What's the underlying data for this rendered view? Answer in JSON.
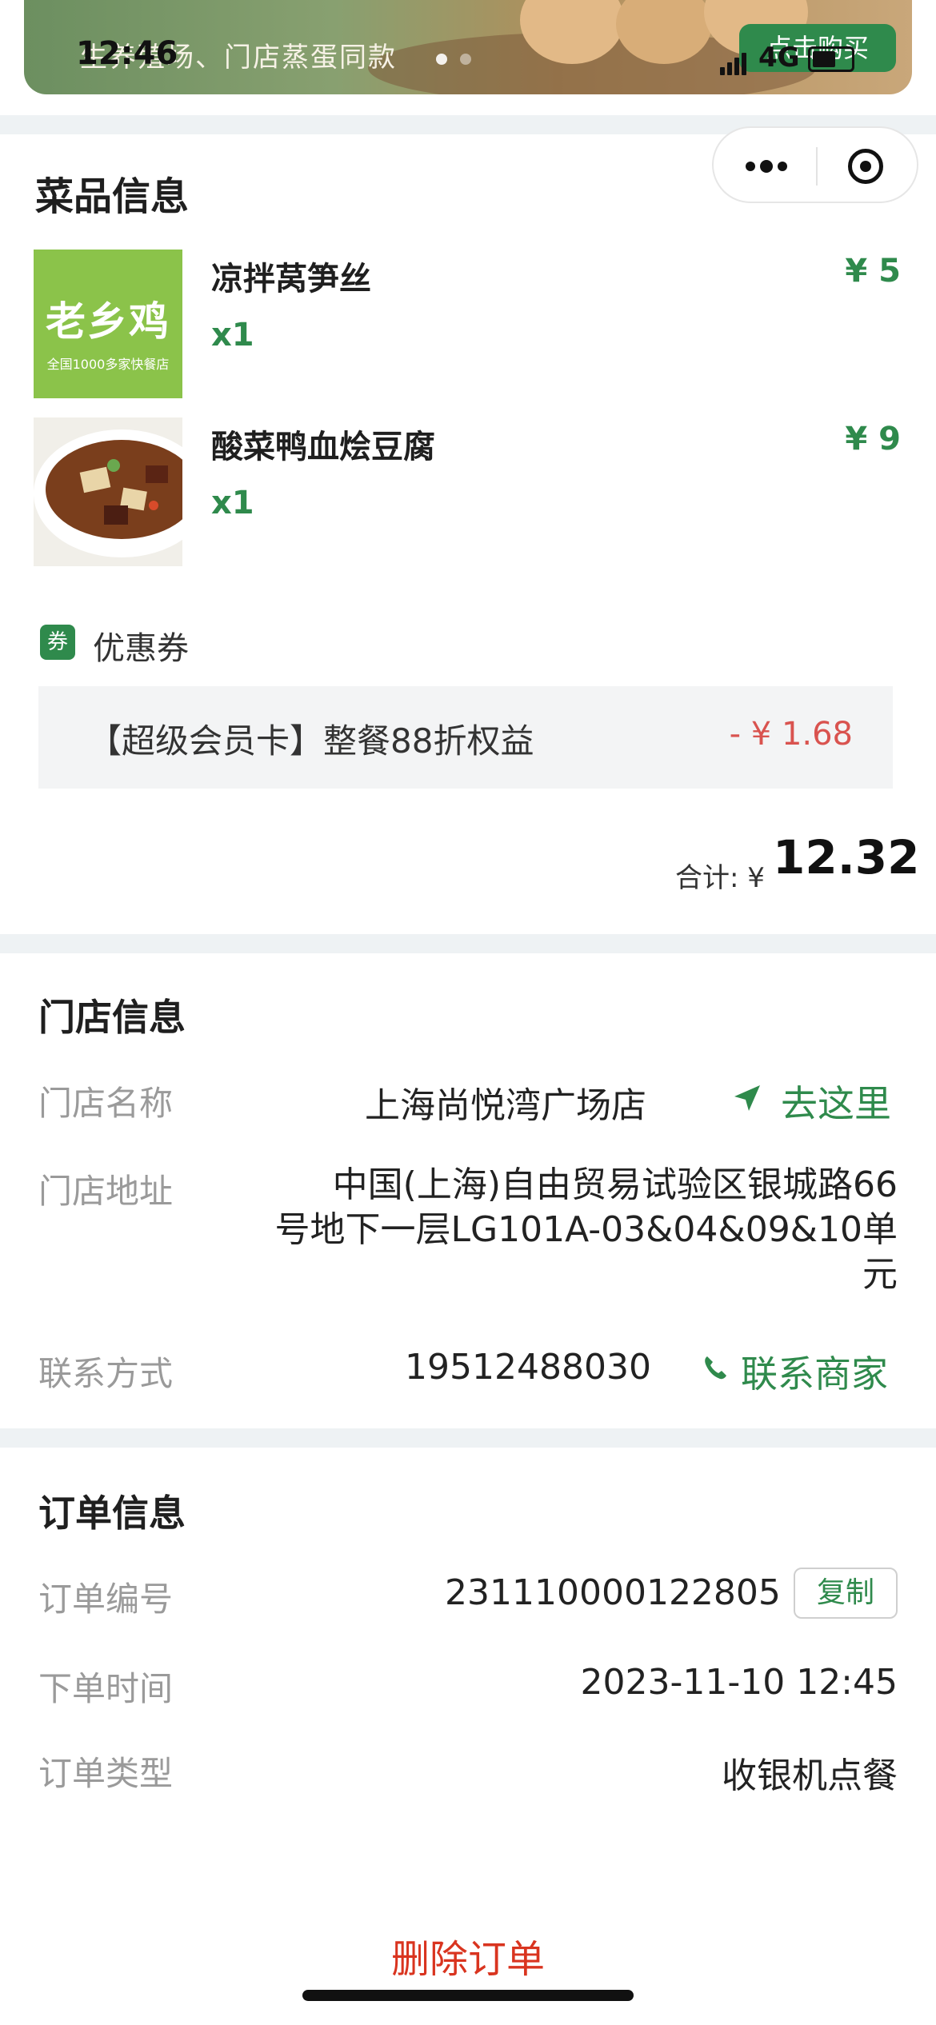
{
  "status_bar": {
    "time": "12:46",
    "network": "4G"
  },
  "banner": {
    "tagline": "生养殖场、门店蒸蛋同款",
    "button_label": "点击购买"
  },
  "dish_section": {
    "title": "菜品信息",
    "items": [
      {
        "name": "凉拌莴笋丝",
        "qty": "x1",
        "price": "¥ 5",
        "thumb": "brand-logo",
        "brand": "老乡鸡",
        "brand_sub": "全国1000多家快餐店"
      },
      {
        "name": "酸菜鸭血烩豆腐",
        "qty": "x1",
        "price": "¥ 9",
        "thumb": "soup-photo"
      }
    ],
    "coupon_badge": "券",
    "coupon_label": "优惠券",
    "coupon": {
      "name": "【超级会员卡】整餐88折权益",
      "amount": "- ¥ 1.68"
    },
    "total_label": "合计: ¥",
    "total_value": "12.32"
  },
  "store_section": {
    "title": "门店信息",
    "name_label": "门店名称",
    "name_value": "上海尚悦湾广场店",
    "navigate_label": "去这里",
    "address_label": "门店地址",
    "address_line1": "中国(上海)自由贸易试验区银城路66",
    "address_line2": "号地下一层LG101A-03&04&09&10单",
    "address_line3": "元",
    "contact_label": "联系方式",
    "contact_value": "19512488030",
    "contact_action": "联系商家"
  },
  "order_section": {
    "title": "订单信息",
    "number_label": "订单编号",
    "number_value": "231110000122805",
    "copy_label": "复制",
    "time_label": "下单时间",
    "time_value": "2023-11-10 12:45",
    "type_label": "订单类型",
    "type_value": "收银机点餐"
  },
  "actions": {
    "delete_label": "删除订单"
  },
  "colors": {
    "accent_green": "#2f8a4c",
    "price_red": "#d9534f",
    "delete_red": "#d9341f",
    "separator": "#eef2f4"
  }
}
